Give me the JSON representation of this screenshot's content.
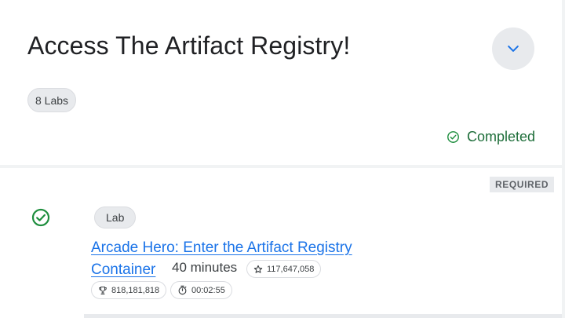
{
  "course": {
    "title": "Access The Artifact Registry!",
    "labs_count": "8 Labs",
    "status": "Completed",
    "expand_icon": "chevron-down-icon"
  },
  "lab": {
    "required": "REQUIRED",
    "type": "Lab",
    "title_line1": "Arcade Hero: Enter the Artifact Registry",
    "title_line2": "Container",
    "duration": "40 minutes",
    "stars": "117,647,058",
    "points": "818,181,818",
    "time": "00:02:55",
    "status_icon": "check-circle-icon"
  },
  "colors": {
    "accent_blue": "#1a73e8",
    "success_green": "#1e8e3e",
    "chip_bg": "#e8eaed"
  }
}
